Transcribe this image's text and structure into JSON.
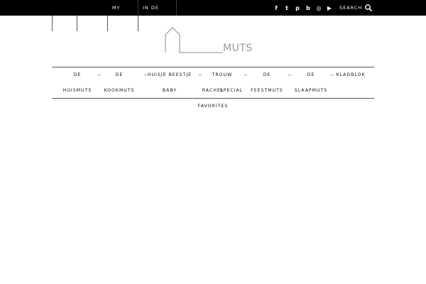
{
  "topbar": {
    "nav": [
      "MY",
      "IN DE"
    ],
    "social_icons": [
      "facebook-icon",
      "twitter-icon",
      "pinterest-icon",
      "bloglovin-icon",
      "instagram-icon",
      "youtube-icon"
    ],
    "social_glyphs": [
      "f",
      "t",
      "p",
      "b",
      "◎",
      "▶"
    ],
    "search_label": "SEARCH"
  },
  "logo": {
    "text": "MUTS"
  },
  "menu": {
    "row1": [
      "DE",
      "DE",
      "HUISJE BEESTJE",
      "TROUW",
      "DE",
      "DE",
      "KLADBLOK"
    ],
    "row2": [
      "HUISMUTS",
      "KOOKMUTS",
      "BABY",
      "RACHEL",
      "SPECIAL",
      "FEESTMUTS",
      "SLAAPMUTS"
    ],
    "row3": [
      "FAVORITES"
    ]
  },
  "colors": {
    "topbar": "#000000",
    "text": "#111111",
    "logo": "#999999"
  }
}
